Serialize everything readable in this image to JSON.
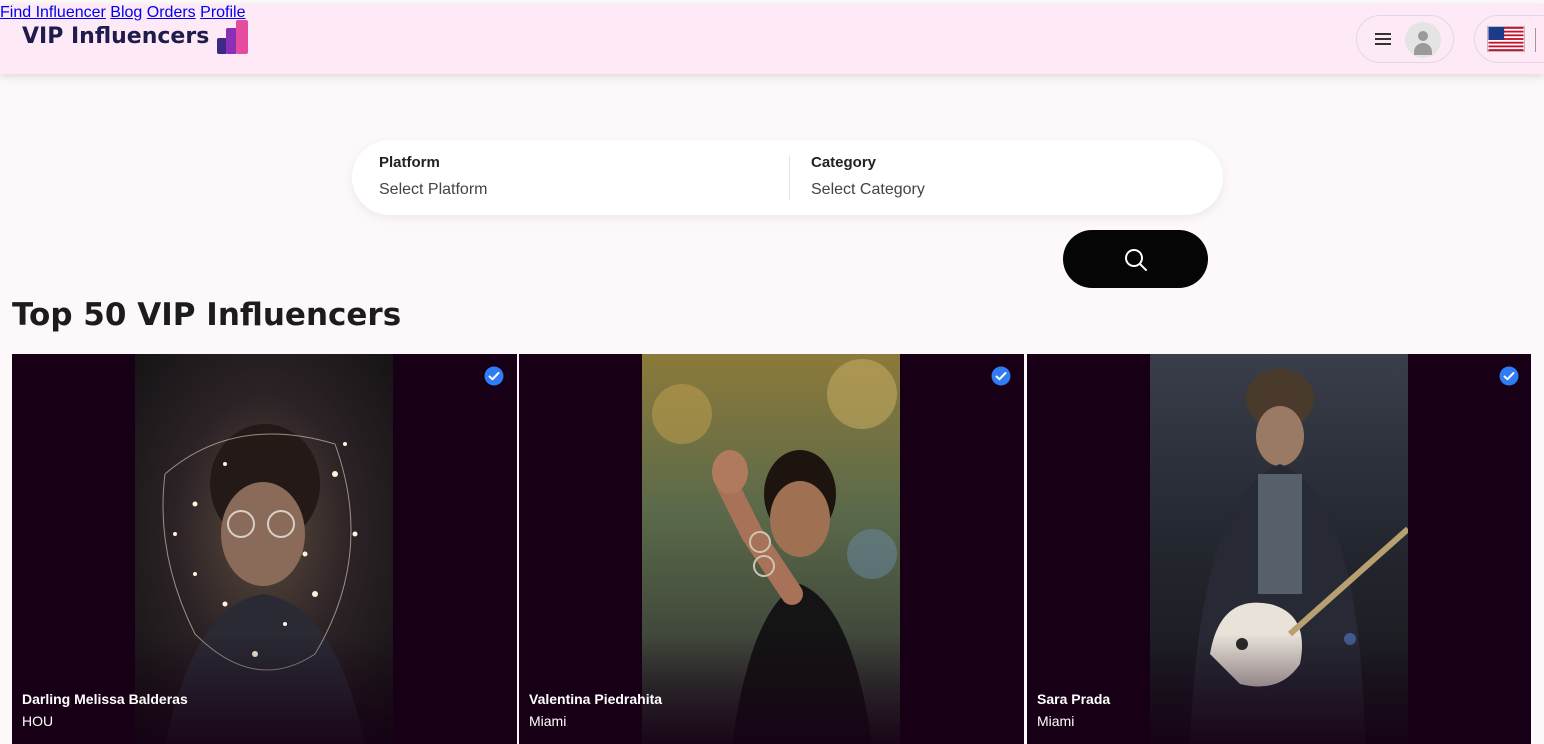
{
  "header": {
    "logo_text": "VIP Influencers",
    "nav": [
      {
        "label": "Find Influencer"
      },
      {
        "label": "Blog"
      },
      {
        "label": "Orders"
      },
      {
        "label": "Profile"
      }
    ],
    "menu_icon": "hamburger-icon",
    "avatar_icon": "user-avatar-icon",
    "language_flag": "us-flag-icon"
  },
  "search": {
    "platform_label": "Platform",
    "platform_value": "Select Platform",
    "category_label": "Category",
    "category_value": "Select Category",
    "button_icon": "search-icon"
  },
  "section_title": "Top 50 VIP Influencers",
  "influencers": [
    {
      "name": "Darling Melissa Balderas",
      "city": "HOU",
      "verified": true
    },
    {
      "name": "Valentina Piedrahita",
      "city": "Miami",
      "verified": true
    },
    {
      "name": "Sara Prada",
      "city": "Miami",
      "verified": true
    }
  ],
  "colors": {
    "header_bg": "#fdeaf6",
    "card_bg": "#170015",
    "verified_badge": "#2f7cf6",
    "search_button": "#050505"
  }
}
